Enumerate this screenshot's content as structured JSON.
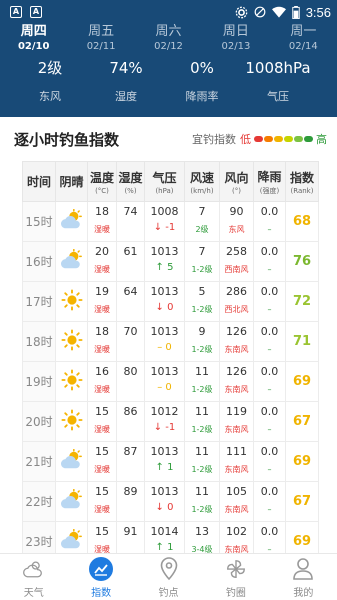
{
  "status": {
    "time": "3:56"
  },
  "dates": [
    {
      "day": "周四",
      "date": "02/10",
      "selected": true
    },
    {
      "day": "周五",
      "date": "02/11",
      "selected": false
    },
    {
      "day": "周六",
      "date": "02/12",
      "selected": false
    },
    {
      "day": "周日",
      "date": "02/13",
      "selected": false
    },
    {
      "day": "周一",
      "date": "02/14",
      "selected": false
    }
  ],
  "weather": [
    {
      "value": "2级",
      "label": "东风"
    },
    {
      "value": "74%",
      "label": "湿度"
    },
    {
      "value": "0%",
      "label": "降雨率"
    },
    {
      "value": "1008hPa",
      "label": "气压"
    }
  ],
  "section": {
    "title": "逐小时钓鱼指数",
    "legend_label": "宜钓指数",
    "legend_low": "低",
    "legend_high": "高",
    "legend_colors": [
      "#e53935",
      "#f57c00",
      "#f0b400",
      "#c6d400",
      "#7cc242",
      "#2e9b3a"
    ]
  },
  "table": {
    "headers": [
      {
        "title": "时间",
        "sub": ""
      },
      {
        "title": "阴晴",
        "sub": ""
      },
      {
        "title": "温度",
        "sub": "(°C)"
      },
      {
        "title": "湿度",
        "sub": "(%)"
      },
      {
        "title": "气压",
        "sub": "(hPa)"
      },
      {
        "title": "风速",
        "sub": "(km/h)"
      },
      {
        "title": "风向",
        "sub": "(°)"
      },
      {
        "title": "降雨",
        "sub": "(强度)"
      },
      {
        "title": "指数",
        "sub": "(Rank)"
      }
    ],
    "rows": [
      {
        "time": "15时",
        "icon": "partly-cloudy",
        "temp": "18",
        "temp_note": "湿暖",
        "hum": "74",
        "pres": "1008",
        "pres_trend": "↓ -1",
        "pres_dir": "down",
        "wind": "7",
        "wind_level": "2级",
        "dir": "90",
        "dir_text": "东风",
        "rain": "0.0",
        "rain_note": "–",
        "index": "68",
        "index_color": "#f0b400"
      },
      {
        "time": "16时",
        "icon": "partly-cloudy",
        "temp": "20",
        "temp_note": "湿暖",
        "hum": "61",
        "pres": "1013",
        "pres_trend": "↑ 5",
        "pres_dir": "up",
        "wind": "7",
        "wind_level": "1-2级",
        "dir": "258",
        "dir_text": "西南风",
        "rain": "0.0",
        "rain_note": "–",
        "index": "76",
        "index_color": "#7cb82f"
      },
      {
        "time": "17时",
        "icon": "sunny",
        "temp": "19",
        "temp_note": "湿暖",
        "hum": "64",
        "pres": "1013",
        "pres_trend": "↓ 0",
        "pres_dir": "down",
        "wind": "5",
        "wind_level": "1-2级",
        "dir": "286",
        "dir_text": "西北风",
        "rain": "0.0",
        "rain_note": "–",
        "index": "72",
        "index_color": "#9ac431"
      },
      {
        "time": "18时",
        "icon": "sunny",
        "temp": "18",
        "temp_note": "湿暖",
        "hum": "70",
        "pres": "1013",
        "pres_trend": "– 0",
        "pres_dir": "flat",
        "wind": "9",
        "wind_level": "1-2级",
        "dir": "126",
        "dir_text": "东南风",
        "rain": "0.0",
        "rain_note": "–",
        "index": "71",
        "index_color": "#9ac431"
      },
      {
        "time": "19时",
        "icon": "sunny",
        "temp": "16",
        "temp_note": "湿暖",
        "hum": "80",
        "pres": "1013",
        "pres_trend": "– 0",
        "pres_dir": "flat",
        "wind": "11",
        "wind_level": "1-2级",
        "dir": "126",
        "dir_text": "东南风",
        "rain": "0.0",
        "rain_note": "–",
        "index": "69",
        "index_color": "#f0b400"
      },
      {
        "time": "20时",
        "icon": "sunny",
        "temp": "15",
        "temp_note": "湿暖",
        "hum": "86",
        "pres": "1012",
        "pres_trend": "↓ -1",
        "pres_dir": "down",
        "wind": "11",
        "wind_level": "1-2级",
        "dir": "119",
        "dir_text": "东南风",
        "rain": "0.0",
        "rain_note": "–",
        "index": "67",
        "index_color": "#f0b400"
      },
      {
        "time": "21时",
        "icon": "partly-cloudy",
        "temp": "15",
        "temp_note": "湿暖",
        "hum": "87",
        "pres": "1013",
        "pres_trend": "↑ 1",
        "pres_dir": "up",
        "wind": "11",
        "wind_level": "1-2级",
        "dir": "111",
        "dir_text": "东南风",
        "rain": "0.0",
        "rain_note": "–",
        "index": "69",
        "index_color": "#f0b400"
      },
      {
        "time": "22时",
        "icon": "partly-cloudy",
        "temp": "15",
        "temp_note": "湿暖",
        "hum": "89",
        "pres": "1013",
        "pres_trend": "↓ 0",
        "pres_dir": "down",
        "wind": "11",
        "wind_level": "1-2级",
        "dir": "105",
        "dir_text": "东南风",
        "rain": "0.0",
        "rain_note": "–",
        "index": "67",
        "index_color": "#f0b400"
      },
      {
        "time": "23时",
        "icon": "partly-cloudy",
        "temp": "15",
        "temp_note": "湿暖",
        "hum": "91",
        "pres": "1014",
        "pres_trend": "↑ 1",
        "pres_dir": "up",
        "wind": "13",
        "wind_level": "3-4级",
        "dir": "102",
        "dir_text": "东南风",
        "rain": "0.0",
        "rain_note": "–",
        "index": "69",
        "index_color": "#f0b400"
      }
    ]
  },
  "nav": [
    {
      "label": "天气",
      "icon": "weather-icon",
      "active": false
    },
    {
      "label": "指数",
      "icon": "index-chart-icon",
      "active": true
    },
    {
      "label": "钓点",
      "icon": "location-pin-icon",
      "active": false
    },
    {
      "label": "钓圈",
      "icon": "pinwheel-icon",
      "active": false
    },
    {
      "label": "我的",
      "icon": "user-icon",
      "active": false
    }
  ]
}
